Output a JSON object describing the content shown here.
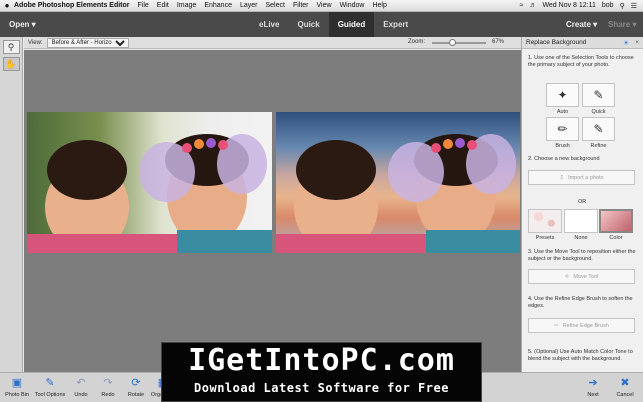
{
  "menubar": {
    "apple": "",
    "app_name": "Adobe Photoshop Elements Editor",
    "items": [
      "File",
      "Edit",
      "Image",
      "Enhance",
      "Layer",
      "Select",
      "Filter",
      "View",
      "Window",
      "Help"
    ],
    "clock": "Wed Nov 8  12:11",
    "user": "bob"
  },
  "topbar": {
    "open_label": "Open",
    "tabs": [
      {
        "label": "eLive"
      },
      {
        "label": "Quick"
      },
      {
        "label": "Guided"
      },
      {
        "label": "Expert"
      }
    ],
    "active_tab": "Guided",
    "create_label": "Create",
    "share_label": "Share"
  },
  "viewbar": {
    "view_label": "View:",
    "view_value": "Before & After - Horizontal",
    "zoom_label": "Zoom:",
    "zoom_value": "67%",
    "zoom_fraction": 0.38
  },
  "panel": {
    "title": "Replace Background",
    "step1": "1. Use one of the Selection Tools to choose the primary subject of your photo.",
    "tools": [
      {
        "label": "Auto",
        "icon": "magic-wand-icon"
      },
      {
        "label": "Quick",
        "icon": "quick-selection-icon"
      },
      {
        "label": "Brush",
        "icon": "brush-icon"
      },
      {
        "label": "Refine",
        "icon": "refine-icon"
      }
    ],
    "step2": "2. Choose a new background",
    "import_label": "Import a photo",
    "or_label": "OR",
    "bg_options": [
      {
        "label": "Presets"
      },
      {
        "label": "None"
      },
      {
        "label": "Color"
      }
    ],
    "step3": "3. Use the Move Tool to reposition either the subject or the background.",
    "move_tool_label": "Move Tool",
    "step4": "4. Use the Refine Edge Brush to soften the edges.",
    "refine_brush_label": "Refine Edge Brush",
    "step5": "5. (Optional) Use Auto Match Color Tone to blend the subject with the background."
  },
  "bottombar": {
    "items": [
      {
        "label": "Photo Bin"
      },
      {
        "label": "Tool Options"
      },
      {
        "label": "Undo"
      },
      {
        "label": "Redo"
      },
      {
        "label": "Rotate"
      },
      {
        "label": "Organizer"
      }
    ],
    "next_label": "Next",
    "cancel_label": "Cancel"
  },
  "watermark": {
    "line1": "IGetIntoPC.com",
    "line2": "Download Latest Software for Free"
  }
}
